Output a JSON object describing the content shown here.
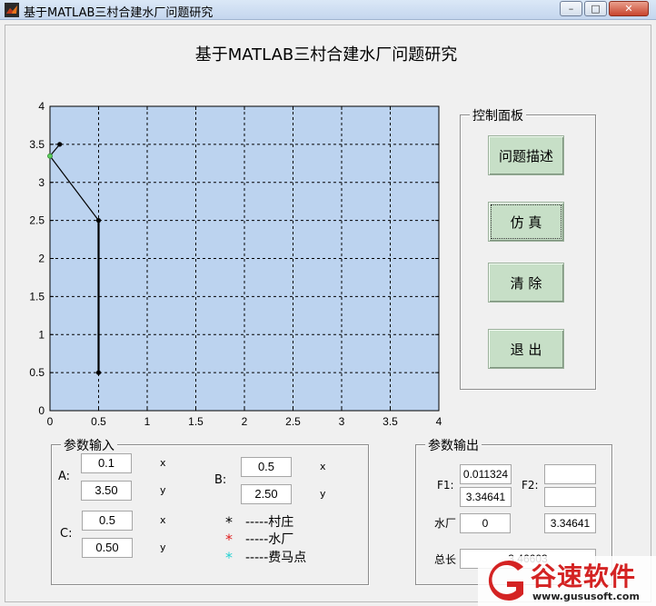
{
  "window": {
    "title": "基于MATLAB三村合建水厂问题研究",
    "minimize_glyph": "–",
    "maximize_glyph": "□",
    "close_glyph": "✕"
  },
  "main_title": "基于MATLAB三村合建水厂问题研究",
  "chart_data": {
    "type": "line",
    "title": "",
    "xlabel": "",
    "ylabel": "",
    "xlim": [
      0,
      4
    ],
    "ylim": [
      0,
      4
    ],
    "xticks": [
      "0",
      "0.5",
      "1",
      "1.5",
      "2",
      "2.5",
      "3",
      "3.5",
      "4"
    ],
    "yticks": [
      "0",
      "0.5",
      "1",
      "1.5",
      "2",
      "2.5",
      "3",
      "3.5",
      "4"
    ],
    "grid": true,
    "background": "#bcd3ef",
    "villages": [
      [
        0.1,
        3.5
      ],
      [
        0.5,
        2.5
      ],
      [
        0.5,
        0.5
      ]
    ],
    "water_plant": [
      0,
      3.34641
    ],
    "segments": [
      {
        "from": [
          0.1,
          3.5
        ],
        "to": [
          0,
          3.34641
        ]
      },
      {
        "from": [
          0,
          3.34641
        ],
        "to": [
          0.5,
          2.5
        ]
      },
      {
        "from": [
          0.5,
          2.5
        ],
        "to": [
          0.5,
          0.5
        ]
      }
    ]
  },
  "control_panel": {
    "legend": "控制面板",
    "btn_describe": "问题描述",
    "btn_simulate": "仿 真",
    "btn_clear": "清 除",
    "btn_exit": "退 出"
  },
  "input_panel": {
    "legend": "参数输入",
    "a_label": "A:",
    "b_label": "B:",
    "c_label": "C:",
    "x_label": "x",
    "y_label": "y",
    "a_x": "0.1",
    "a_y": "3.50",
    "b_x": "0.5",
    "b_y": "2.50",
    "c_x": "0.5",
    "c_y": "0.50",
    "legend_village": "-----村庄",
    "legend_plant": "-----水厂",
    "legend_fermat": "-----费马点",
    "star_glyph": "*",
    "star_colors": {
      "village": "#000000",
      "plant": "#e02020",
      "fermat": "#22d0d0"
    }
  },
  "output_panel": {
    "legend": "参数输出",
    "f1_label": "F1:",
    "f2_label": "F2:",
    "f1_a": "0.011324",
    "f1_b": "3.34641",
    "f2_a": "",
    "f2_b": "",
    "plant_label": "水厂",
    "plant_x": "0",
    "plant_y": "3.34641",
    "total_label": "总长",
    "total_value": "3.46603"
  },
  "watermark": {
    "brand": "谷速软件",
    "url": "www.gususoft.com",
    "color": "#d42323"
  }
}
